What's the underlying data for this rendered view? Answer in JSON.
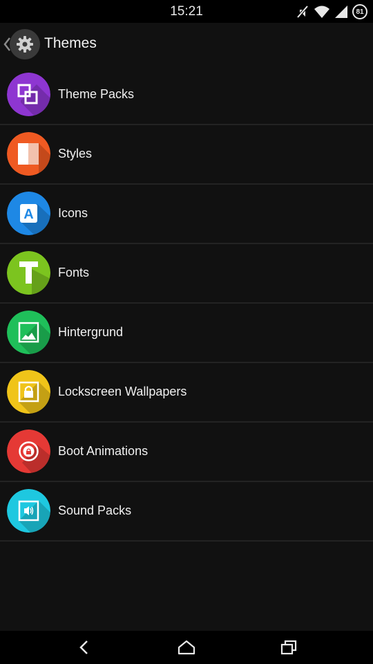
{
  "status_bar": {
    "time": "15:21",
    "battery_level": "81",
    "icons": [
      "mute-icon",
      "wifi-icon",
      "signal-icon",
      "battery-icon"
    ]
  },
  "action_bar": {
    "title": "Themes",
    "icon": "gear-icon"
  },
  "items": [
    {
      "label": "Theme Packs",
      "icon": "theme-packs-icon",
      "color": "#8e36d1"
    },
    {
      "label": "Styles",
      "icon": "styles-icon",
      "color": "#ef5a22"
    },
    {
      "label": "Icons",
      "icon": "icons-icon",
      "color": "#1e88e5"
    },
    {
      "label": "Fonts",
      "icon": "fonts-icon",
      "color": "#7cc41f"
    },
    {
      "label": "Hintergrund",
      "icon": "wallpaper-icon",
      "color": "#1fbf5a"
    },
    {
      "label": "Lockscreen Wallpapers",
      "icon": "lockscreen-icon",
      "color": "#f0c419"
    },
    {
      "label": "Boot Animations",
      "icon": "boot-animation-icon",
      "color": "#e53935"
    },
    {
      "label": "Sound Packs",
      "icon": "sound-packs-icon",
      "color": "#1ec8e0"
    }
  ],
  "nav_bar": {
    "buttons": [
      "back-icon",
      "home-icon",
      "recents-icon"
    ]
  }
}
